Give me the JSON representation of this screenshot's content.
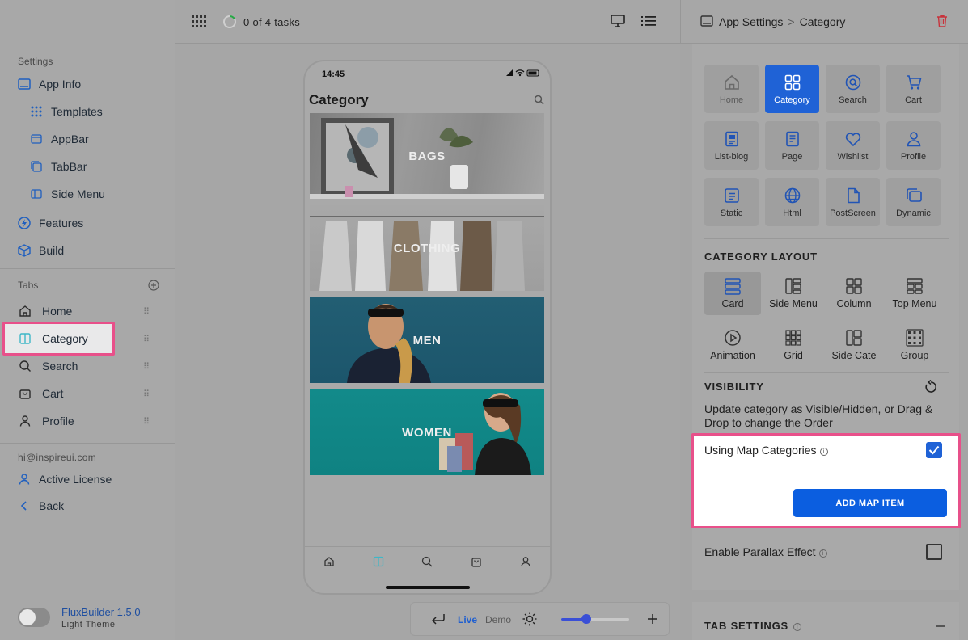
{
  "sidebar": {
    "settings_header": "Settings",
    "items": [
      {
        "label": "App Info"
      },
      {
        "label": "Templates"
      },
      {
        "label": "AppBar"
      },
      {
        "label": "TabBar"
      },
      {
        "label": "Side Menu"
      },
      {
        "label": "Features"
      },
      {
        "label": "Build"
      }
    ],
    "tabs_header": "Tabs",
    "tabs": [
      {
        "label": "Home"
      },
      {
        "label": "Category"
      },
      {
        "label": "Search"
      },
      {
        "label": "Cart"
      },
      {
        "label": "Profile"
      }
    ],
    "email": "hi@inspireui.com",
    "active_license": "Active License",
    "back": "Back",
    "version": "FluxBuilder 1.5.0",
    "theme": "Light Theme"
  },
  "topbar": {
    "tasks": "0 of 4 tasks"
  },
  "breadcrumb": {
    "root": "App Settings",
    "separator": ">",
    "current": "Category"
  },
  "phone": {
    "time": "14:45",
    "title": "Category",
    "categories": [
      "BAGS",
      "CLOTHING",
      "MEN",
      "WOMEN"
    ]
  },
  "bottom_controls": {
    "live": "Live",
    "demo": "Demo"
  },
  "screens": [
    {
      "label": "Home",
      "icon": "home-icon"
    },
    {
      "label": "Category",
      "icon": "grid-icon"
    },
    {
      "label": "Search",
      "icon": "search-icon"
    },
    {
      "label": "Cart",
      "icon": "cart-icon"
    },
    {
      "label": "List-blog",
      "icon": "blog-icon"
    },
    {
      "label": "Page",
      "icon": "page-icon"
    },
    {
      "label": "Wishlist",
      "icon": "heart-icon"
    },
    {
      "label": "Profile",
      "icon": "person-icon"
    },
    {
      "label": "Static",
      "icon": "static-icon"
    },
    {
      "label": "Html",
      "icon": "globe-icon"
    },
    {
      "label": "PostScreen",
      "icon": "document-icon"
    },
    {
      "label": "Dynamic",
      "icon": "dynamic-icon"
    }
  ],
  "category_layout": {
    "title": "CATEGORY LAYOUT",
    "options": [
      {
        "label": "Card"
      },
      {
        "label": "Side Menu"
      },
      {
        "label": "Column"
      },
      {
        "label": "Top Menu"
      },
      {
        "label": "Animation"
      },
      {
        "label": "Grid"
      },
      {
        "label": "Side Cate"
      },
      {
        "label": "Group"
      }
    ],
    "selected": "Card"
  },
  "visibility": {
    "title": "VISIBILITY",
    "description": "Update category as Visible/Hidden, or Drag & Drop to change the Order",
    "map_label": "Using Map Categories",
    "map_checked": true,
    "add_map_button": "ADD MAP ITEM",
    "parallax_label": "Enable Parallax Effect",
    "parallax_checked": false
  },
  "tab_settings": {
    "title": "TAB SETTINGS"
  },
  "colors": {
    "accent": "#1f62d6",
    "highlight": "#e8508a"
  }
}
